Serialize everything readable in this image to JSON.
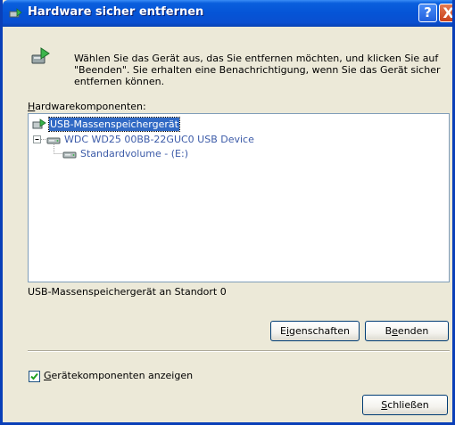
{
  "window": {
    "title": "Hardware sicher entfernen",
    "help_button": "?",
    "close_button": "X"
  },
  "instructions": "Wählen Sie das Gerät aus, das Sie entfernen möchten, und klicken Sie auf \"Beenden\". Sie erhalten eine Benachrichtigung, wenn Sie das Gerät sicher entfernen können.",
  "hardware_label": {
    "accel": "H",
    "rest": "ardwarekomponenten:"
  },
  "tree": {
    "items": [
      {
        "label": "USB-Massenspeichergerät",
        "icon": "usb-device-icon",
        "selected": true
      },
      {
        "label": "WDC WD25 00BB-22GUC0 USB Device",
        "icon": "disk-drive-icon",
        "selected": false
      },
      {
        "label": "Standardvolume - (E:)",
        "icon": "volume-icon",
        "selected": false
      }
    ]
  },
  "status_text": "USB-Massenspeichergerät an Standort 0",
  "buttons": {
    "properties": {
      "pre": "E",
      "accel": "i",
      "post": "genschaften"
    },
    "stop": {
      "pre": "B",
      "accel": "e",
      "post": "enden"
    },
    "close": {
      "pre": "",
      "accel": "S",
      "post": "chließen"
    }
  },
  "checkbox": {
    "checked": true,
    "accel": "G",
    "rest": "erätekomponenten anzeigen"
  },
  "colors": {
    "titlebar": "#0554d6",
    "dialog_bg": "#ece9d8",
    "selection": "#316ac5",
    "checkmark": "#21a121"
  }
}
